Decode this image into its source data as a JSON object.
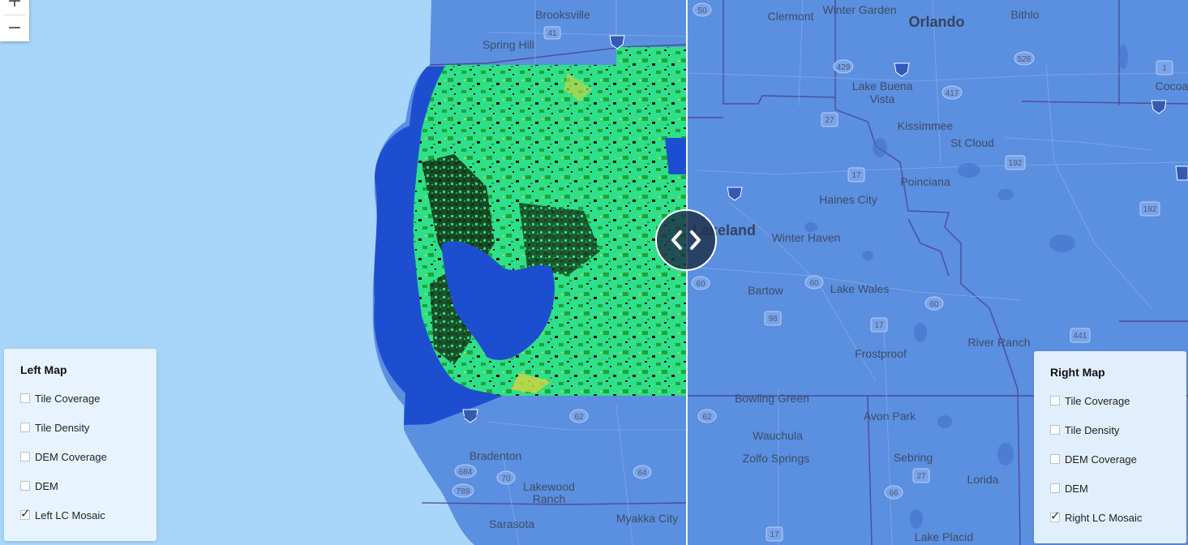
{
  "map": {
    "colors": {
      "water": "#a8d6fb",
      "land_overlay": "#5b8fe0",
      "county_lines": "#4a3c86",
      "lc_vegetation": "#2fe08a",
      "lc_forest": "#1fa43a",
      "lc_urban": "#0b1a10",
      "lc_water": "#1e4ed0",
      "lc_ag": "#d6d43a"
    },
    "places": [
      {
        "name": "Brooksville"
      },
      {
        "name": "Spring Hill"
      },
      {
        "name": "Clermont"
      },
      {
        "name": "Winter Garden"
      },
      {
        "name": "Orlando"
      },
      {
        "name": "Bithlo"
      },
      {
        "name": "Cocoa"
      },
      {
        "name": "Lake Buena"
      },
      {
        "name": "Vista"
      },
      {
        "name": "Kissimmee"
      },
      {
        "name": "St Cloud"
      },
      {
        "name": "Poinciana"
      },
      {
        "name": "Haines City"
      },
      {
        "name": "Lakeland"
      },
      {
        "name": "Winter Haven"
      },
      {
        "name": "Bartow"
      },
      {
        "name": "Lake Wales"
      },
      {
        "name": "Frostproof"
      },
      {
        "name": "River Ranch"
      },
      {
        "name": "Bowling Green"
      },
      {
        "name": "Wauchula"
      },
      {
        "name": "Zolfo Springs"
      },
      {
        "name": "Avon Park"
      },
      {
        "name": "Sebring"
      },
      {
        "name": "Lorida"
      },
      {
        "name": "Bradenton"
      },
      {
        "name": "Lakewood"
      },
      {
        "name": "Ranch"
      },
      {
        "name": "Sarasota"
      },
      {
        "name": "Myakka City"
      },
      {
        "name": "Lake Placid"
      }
    ],
    "shields": [
      "50",
      "41",
      "75",
      "429",
      "4",
      "528",
      "417",
      "1",
      "95",
      "27",
      "17",
      "192",
      "4",
      "192",
      "95",
      "60",
      "60",
      "98",
      "60",
      "17",
      "441",
      "62",
      "275",
      "62",
      "684",
      "70",
      "64",
      "789",
      "66",
      "27",
      "17"
    ]
  },
  "zoom": {
    "in_label": "+",
    "out_label": "−"
  },
  "compare": {
    "handle_icon": "chevron-left-right"
  },
  "left_panel": {
    "title": "Left Map",
    "layers": [
      {
        "label": "Tile Coverage",
        "checked": false
      },
      {
        "label": "Tile Density",
        "checked": false
      },
      {
        "label": "DEM Coverage",
        "checked": false
      },
      {
        "label": "DEM",
        "checked": false
      },
      {
        "label": "Left LC Mosaic",
        "checked": true
      }
    ]
  },
  "right_panel": {
    "title": "Right Map",
    "layers": [
      {
        "label": "Tile Coverage",
        "checked": false
      },
      {
        "label": "Tile Density",
        "checked": false
      },
      {
        "label": "DEM Coverage",
        "checked": false
      },
      {
        "label": "DEM",
        "checked": false
      },
      {
        "label": "Right LC Mosaic",
        "checked": true
      }
    ]
  }
}
